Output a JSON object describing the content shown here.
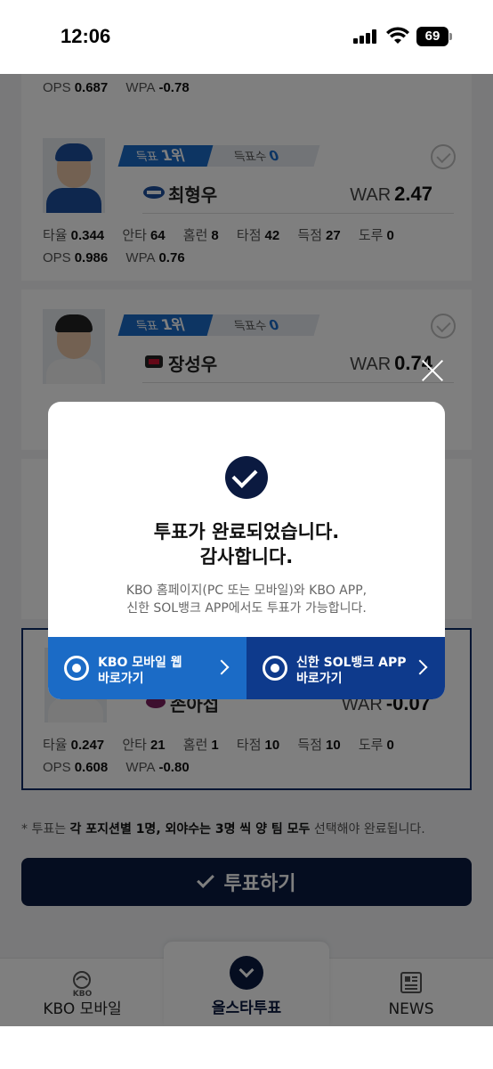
{
  "status_bar": {
    "time": "12:06",
    "battery": "69"
  },
  "cards": [
    {
      "stats_line2": [
        {
          "k": "OPS",
          "v": "0.687"
        },
        {
          "k": "WPA",
          "v": "-0.78"
        }
      ]
    },
    {
      "rank_label": "득표",
      "rank_value": "1위",
      "votes_label": "득표수",
      "votes_value": "0",
      "player_name": "최형우",
      "war_label": "WAR",
      "war_value": "2.47",
      "stats_line1": [
        {
          "k": "타율",
          "v": "0.344"
        },
        {
          "k": "안타",
          "v": "64"
        },
        {
          "k": "홈런",
          "v": "8"
        },
        {
          "k": "타점",
          "v": "42"
        },
        {
          "k": "득점",
          "v": "27"
        },
        {
          "k": "도루",
          "v": "0"
        }
      ],
      "stats_line2": [
        {
          "k": "OPS",
          "v": "0.986"
        },
        {
          "k": "WPA",
          "v": "0.76"
        }
      ]
    },
    {
      "rank_label": "득표",
      "rank_value": "1위",
      "votes_label": "득표수",
      "votes_value": "0",
      "player_name": "장성우",
      "war_label": "WAR",
      "war_value": "0.74"
    },
    {
      "player_name": "손아섭",
      "war_label": "WAR",
      "war_value": "-0.07",
      "stats_line1": [
        {
          "k": "타율",
          "v": "0.247"
        },
        {
          "k": "안타",
          "v": "21"
        },
        {
          "k": "홈런",
          "v": "1"
        },
        {
          "k": "타점",
          "v": "10"
        },
        {
          "k": "득점",
          "v": "10"
        },
        {
          "k": "도루",
          "v": "0"
        }
      ],
      "stats_line2": [
        {
          "k": "OPS",
          "v": "0.608"
        },
        {
          "k": "WPA",
          "v": "-0.80"
        }
      ]
    }
  ],
  "notice": {
    "prefix": "* 투표는 ",
    "bold1": "각 포지션별 1명, 외야수는 3명 씩 양 팀 모두",
    "suffix": " 선택해야 완료됩니다."
  },
  "vote_button": "투표하기",
  "bottom_nav": {
    "kbo_small": "KBO",
    "kbo_mobile": "KBO 모바일",
    "allstar": "올스타투표",
    "news": "NEWS"
  },
  "modal": {
    "title_line1": "투표가 완료되었습니다.",
    "title_line2": "감사합니다.",
    "desc_line1": "KBO 홈페이지(PC 또는 모바일)와 KBO APP,",
    "desc_line2": "신한 SOL뱅크 APP에서도 투표가 가능합니다.",
    "btn_kbo_line1": "KBO 모바일 웹",
    "btn_kbo_line2": "바로가기",
    "btn_sol_line1": "신한 SOL뱅크 APP",
    "btn_sol_line2": "바로가기"
  },
  "colors": {
    "primary_navy": "#0b1a40",
    "accent_blue": "#1b6bc6",
    "sol_blue": "#0e3a8c"
  }
}
